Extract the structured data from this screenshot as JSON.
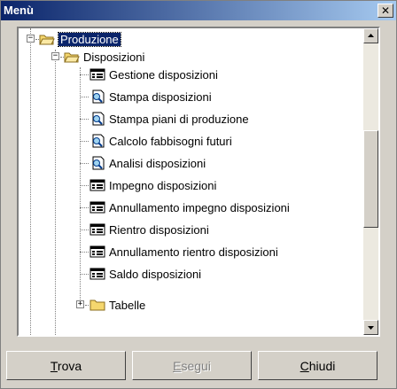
{
  "window": {
    "title": "Menù",
    "close_symbol": "✕"
  },
  "tree": {
    "root_label": "Produzione",
    "folder_label": "Disposizioni",
    "items": [
      {
        "label": "Gestione disposizioni",
        "icon": "form-icon"
      },
      {
        "label": "Stampa disposizioni",
        "icon": "report-icon"
      },
      {
        "label": "Stampa piani di produzione",
        "icon": "report-icon"
      },
      {
        "label": "Calcolo fabbisogni futuri",
        "icon": "report-icon"
      },
      {
        "label": "Analisi disposizioni",
        "icon": "report-icon"
      },
      {
        "label": "Impegno disposizioni",
        "icon": "form-icon"
      },
      {
        "label": "Annullamento impegno disposizioni",
        "icon": "form-icon"
      },
      {
        "label": "Rientro disposizioni",
        "icon": "form-icon"
      },
      {
        "label": "Annullamento rientro disposizioni",
        "icon": "form-icon"
      },
      {
        "label": "Saldo disposizioni",
        "icon": "form-icon"
      }
    ],
    "sub_folder_label": "Tabelle"
  },
  "buttons": {
    "trova": {
      "first": "T",
      "rest": "rova"
    },
    "esegui": {
      "first": "E",
      "rest": "segui"
    },
    "chiudi": {
      "first": "C",
      "rest": "hiudi"
    }
  }
}
